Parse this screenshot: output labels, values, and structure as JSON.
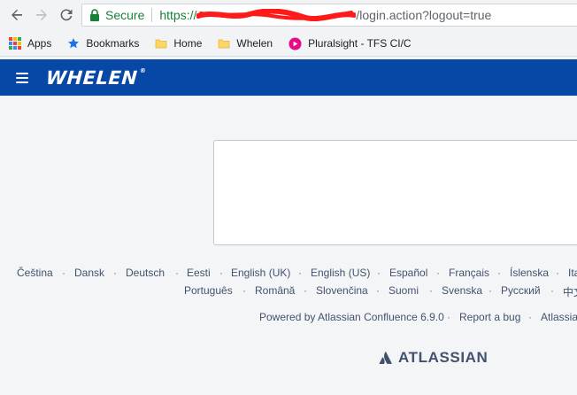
{
  "browser": {
    "secure_label": "Secure",
    "url_scheme": "https://",
    "url_path": "/login.action?logout=true"
  },
  "bookmarks": {
    "items": [
      {
        "label": "Apps"
      },
      {
        "label": "Bookmarks"
      },
      {
        "label": "Home"
      },
      {
        "label": "Whelen"
      },
      {
        "label": "Pluralsight - TFS CI/C"
      }
    ]
  },
  "header": {
    "logo_text": "WHELEN",
    "logo_mark": "®"
  },
  "footer": {
    "languages_row1": [
      "Čeština",
      "Dansk",
      "Deutsch",
      "Eesti",
      "English (UK)",
      "English (US)",
      "Español",
      "Français",
      "Íslenska",
      "Ita"
    ],
    "languages_row2": [
      "Português",
      "Română",
      "Slovenčina",
      "Suomi",
      "Svenska",
      "Русский",
      "中文"
    ],
    "links": [
      "Powered by Atlassian Confluence 6.9.0",
      "Report a bug",
      "Atlassian"
    ],
    "separator": "·",
    "atlassian_logo": "ATLASSIAN"
  },
  "colors": {
    "header_bg": "#0747a6",
    "secure_green": "#188038",
    "page_bg": "#f4f5f7"
  }
}
